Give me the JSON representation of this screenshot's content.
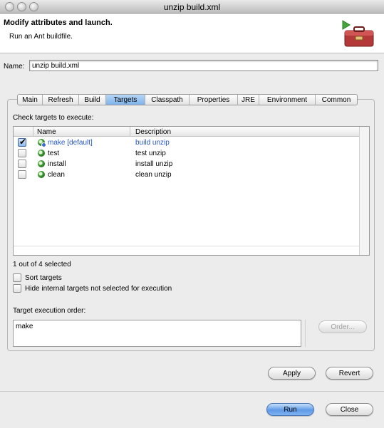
{
  "window": {
    "title": "unzip build.xml"
  },
  "header": {
    "title": "Modify attributes and launch.",
    "description": "Run an Ant buildfile.",
    "icon": "toolbox-run-icon"
  },
  "name_field": {
    "label": "Name:",
    "value": "unzip build.xml"
  },
  "tabs": [
    {
      "label": "Main"
    },
    {
      "label": "Refresh"
    },
    {
      "label": "Build"
    },
    {
      "label": "Targets",
      "active": true
    },
    {
      "label": "Classpath"
    },
    {
      "label": "Properties"
    },
    {
      "label": "JRE"
    },
    {
      "label": "Environment"
    },
    {
      "label": "Common"
    }
  ],
  "targets": {
    "heading": "Check targets to execute:",
    "columns": {
      "name": "Name",
      "description": "Description"
    },
    "rows": [
      {
        "name": "make [default]",
        "description": "build unzip",
        "checked": true
      },
      {
        "name": "test",
        "description": "test unzip",
        "checked": false
      },
      {
        "name": "install",
        "description": "install unzip",
        "checked": false
      },
      {
        "name": "clean",
        "description": "clean unzip",
        "checked": false
      }
    ],
    "selected_count": "1 out of 4 selected",
    "sort_label": "Sort targets",
    "hide_label": "Hide internal targets not selected for execution",
    "order_label": "Target execution order:",
    "order_value": "make",
    "order_button": "Order..."
  },
  "buttons": {
    "apply": "Apply",
    "revert": "Revert",
    "run": "Run",
    "close": "Close"
  },
  "colors": {
    "default_target": "#2656c9",
    "active_tab": "#7fb2ea",
    "run_button": "#5f9ae6"
  }
}
